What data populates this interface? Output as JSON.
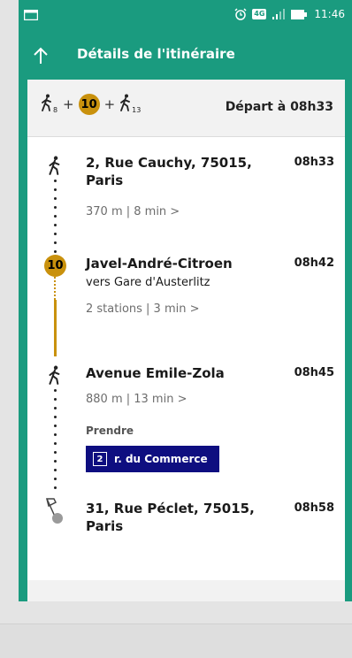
{
  "status_bar": {
    "time": "11:46",
    "network": "4G"
  },
  "app_bar": {
    "title": "Détails de l'itinéraire"
  },
  "summary": {
    "walk1_minutes": "8",
    "line_number": "10",
    "walk2_minutes": "13",
    "plus": "+",
    "depart": "Départ à 08h33"
  },
  "steps": [
    {
      "title": "2, Rue Cauchy, 75015, Paris",
      "time": "08h33",
      "meta": "370 m  |  8 min  >"
    },
    {
      "title": "Javel-André-Citroen",
      "time": "08h42",
      "sub": "vers Gare d'Austerlitz",
      "meta": "2 stations  |  3 min  >"
    },
    {
      "title": "Avenue Emile-Zola",
      "time": "08h45",
      "meta": "880 m  |  13 min  >",
      "prendre": "Prendre",
      "bus_number": "2",
      "bus_stop": "r. du Commerce"
    },
    {
      "title": "31, Rue Péclet, 75015, Paris",
      "time": "08h58"
    }
  ],
  "colors": {
    "header": "#1a9b7f",
    "metro": "#c9910d",
    "bus": "#0e0e80"
  }
}
